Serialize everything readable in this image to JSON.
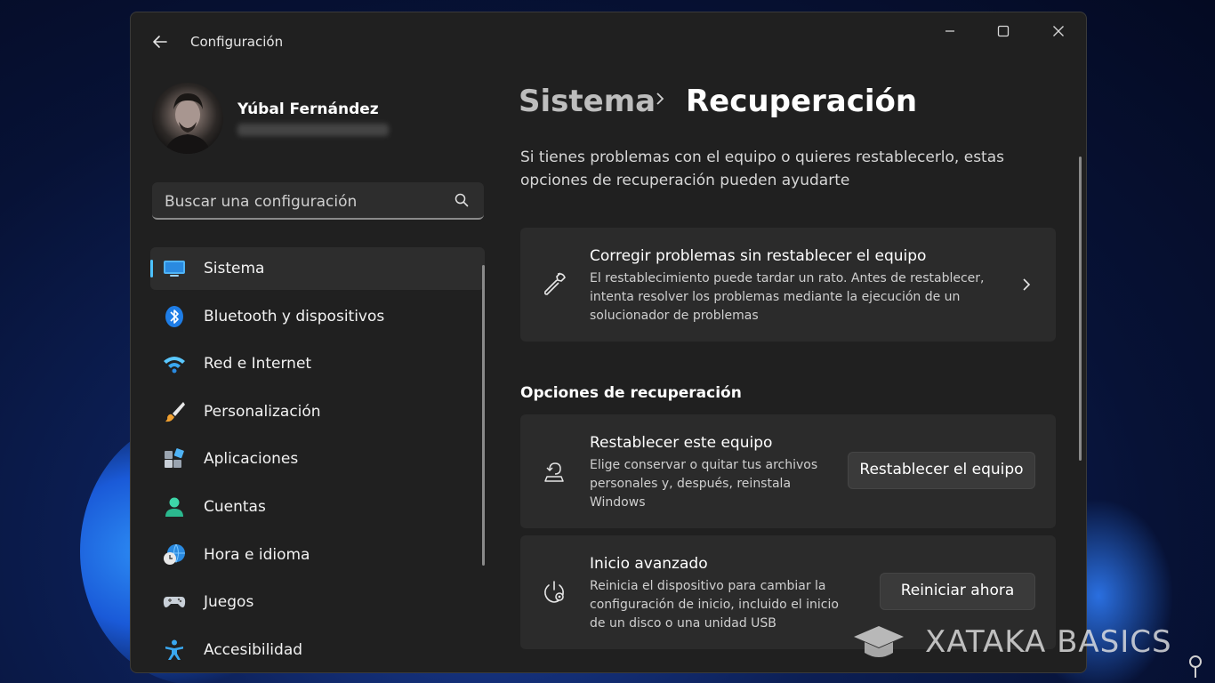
{
  "window": {
    "title": "Configuración"
  },
  "profile": {
    "name": "Yúbal Fernández"
  },
  "search": {
    "placeholder": "Buscar una configuración"
  },
  "nav": [
    {
      "label": "Sistema",
      "icon": "monitor-icon",
      "active": true
    },
    {
      "label": "Bluetooth y dispositivos",
      "icon": "bluetooth-icon"
    },
    {
      "label": "Red e Internet",
      "icon": "wifi-icon"
    },
    {
      "label": "Personalización",
      "icon": "brush-icon"
    },
    {
      "label": "Aplicaciones",
      "icon": "apps-icon"
    },
    {
      "label": "Cuentas",
      "icon": "person-icon"
    },
    {
      "label": "Hora e idioma",
      "icon": "globe-clock-icon"
    },
    {
      "label": "Juegos",
      "icon": "gamepad-icon"
    },
    {
      "label": "Accesibilidad",
      "icon": "accessibility-icon"
    }
  ],
  "breadcrumb": {
    "parent": "Sistema",
    "current": "Recuperación"
  },
  "intro": "Si tienes problemas con el equipo o quieres restablecerlo, estas opciones de recuperación pueden ayudarte",
  "cards": {
    "fix": {
      "title": "Corregir problemas sin restablecer el equipo",
      "desc_lines": [
        "El restablecimiento puede tardar un rato. Antes de restablecer,",
        "intenta resolver los problemas mediante la ejecución de un",
        "solucionador de problemas"
      ]
    },
    "section_title": "Opciones de recuperación",
    "reset": {
      "title": "Restablecer este equipo",
      "desc_lines": [
        "Elige conservar o quitar tus archivos",
        "personales y, después, reinstala",
        "Windows"
      ],
      "button": "Restablecer el equipo"
    },
    "advanced": {
      "title": "Inicio avanzado",
      "desc_lines": [
        "Reinicia el dispositivo para cambiar la",
        "configuración de inicio, incluido el inicio",
        "de un disco o una unidad USB"
      ],
      "button": "Reiniciar ahora"
    }
  },
  "watermark": {
    "text": "XATAKA BASICS"
  },
  "colors": {
    "accent": "#4cc2ff",
    "window_bg": "#202020",
    "card_bg": "#2b2b2b"
  }
}
